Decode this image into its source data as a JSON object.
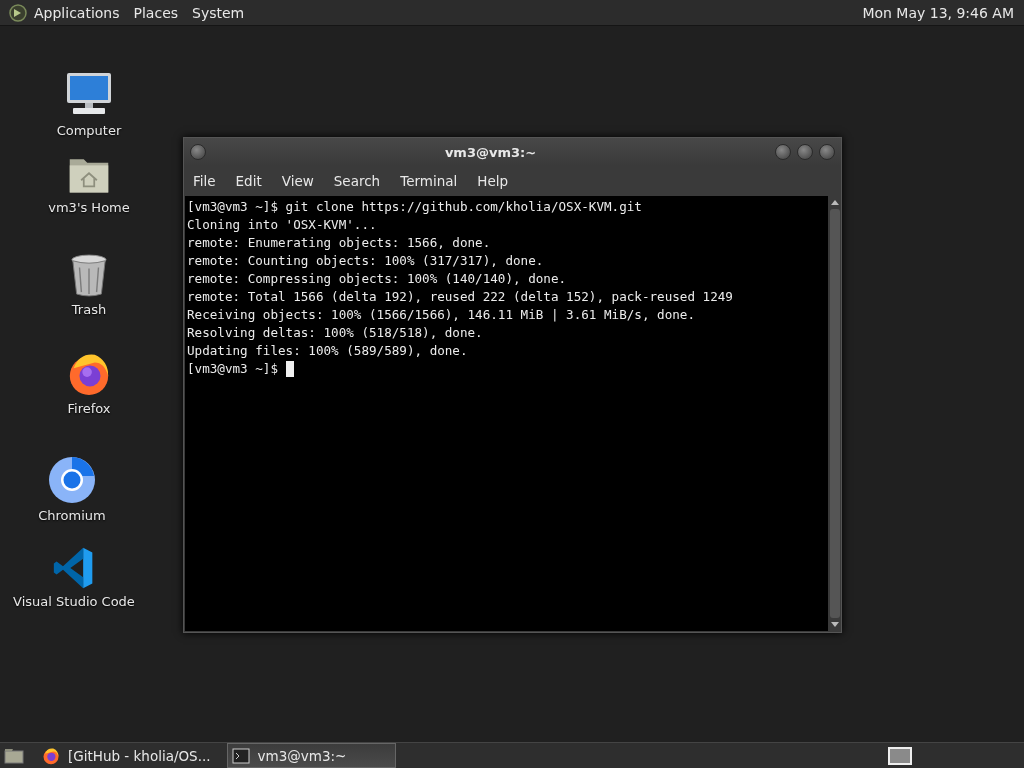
{
  "top_panel": {
    "menus": [
      "Applications",
      "Places",
      "System"
    ],
    "clock": "Mon May 13,  9:46 AM"
  },
  "desktop_icons": [
    {
      "label": "Computer",
      "kind": "computer"
    },
    {
      "label": "vm3's Home",
      "kind": "home"
    },
    {
      "label": "Trash",
      "kind": "trash"
    },
    {
      "label": "Firefox",
      "kind": "firefox"
    },
    {
      "label": "Chromium",
      "kind": "chromium"
    },
    {
      "label": "Visual Studio Code",
      "kind": "vscode"
    }
  ],
  "window": {
    "title": "vm3@vm3:~",
    "menu": [
      "File",
      "Edit",
      "View",
      "Search",
      "Terminal",
      "Help"
    ],
    "lines": [
      "[vm3@vm3 ~]$ git clone https://github.com/kholia/OSX-KVM.git",
      "Cloning into 'OSX-KVM'...",
      "remote: Enumerating objects: 1566, done.",
      "remote: Counting objects: 100% (317/317), done.",
      "remote: Compressing objects: 100% (140/140), done.",
      "remote: Total 1566 (delta 192), reused 222 (delta 152), pack-reused 1249",
      "Receiving objects: 100% (1566/1566), 146.11 MiB | 3.61 MiB/s, done.",
      "Resolving deltas: 100% (518/518), done.",
      "Updating files: 100% (589/589), done."
    ],
    "prompt": "[vm3@vm3 ~]$"
  },
  "taskbar": {
    "tasks": [
      {
        "label": "[GitHub - kholia/OS...",
        "kind": "firefox",
        "selected": false
      },
      {
        "label": "vm3@vm3:~",
        "kind": "terminal",
        "selected": true
      }
    ]
  }
}
